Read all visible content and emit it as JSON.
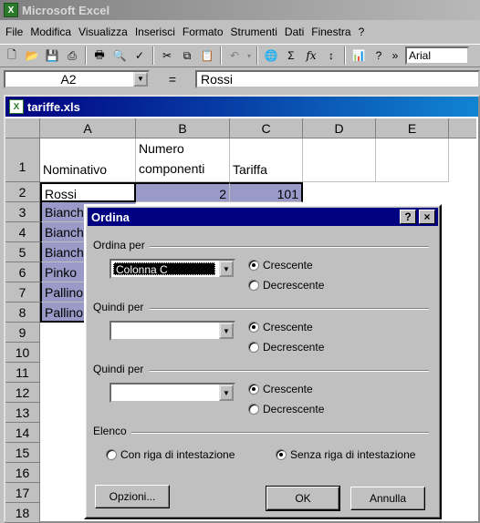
{
  "app": {
    "title": "Microsoft Excel",
    "icon": "X"
  },
  "menu": [
    "File",
    "Modifica",
    "Visualizza",
    "Inserisci",
    "Formato",
    "Strumenti",
    "Dati",
    "Finestra",
    "?"
  ],
  "toolbar": {
    "font": "Arial"
  },
  "formula_bar": {
    "cell_ref": "A2",
    "equals": "=",
    "value": "Rossi"
  },
  "workbook": {
    "title": "tariffe.xls",
    "columns": [
      "A",
      "B",
      "C",
      "D",
      "E"
    ],
    "rows": [
      "1",
      "2",
      "3",
      "4",
      "5",
      "6",
      "7",
      "8",
      "9",
      "10",
      "11",
      "12",
      "13",
      "14",
      "15",
      "16",
      "17",
      "18"
    ],
    "cells": {
      "a1": "Nominativo",
      "b1_line1": "Numero",
      "b1_line2": "componenti",
      "c1": "Tariffa",
      "a2": "Rossi",
      "b2": "2",
      "c2": "101",
      "a3": "Bianch",
      "a4": "Bianch",
      "a5": "Bianch",
      "a6": "Pinko",
      "a7": "Pallino",
      "a8": "Pallino"
    }
  },
  "dialog": {
    "title": "Ordina",
    "help": "?",
    "close": "×",
    "sort_by_label": "Ordina per",
    "sort_by_value": "Colonna C",
    "then_by_label_1": "Quindi per",
    "then_by_label_2": "Quindi per",
    "ascending": "Crescente",
    "descending": "Decrescente",
    "list_label": "Elenco",
    "with_header": "Con riga di intestazione",
    "without_header": "Senza riga di intestazione",
    "options_button": "Opzioni...",
    "ok_button": "OK",
    "cancel_button": "Annulla"
  }
}
